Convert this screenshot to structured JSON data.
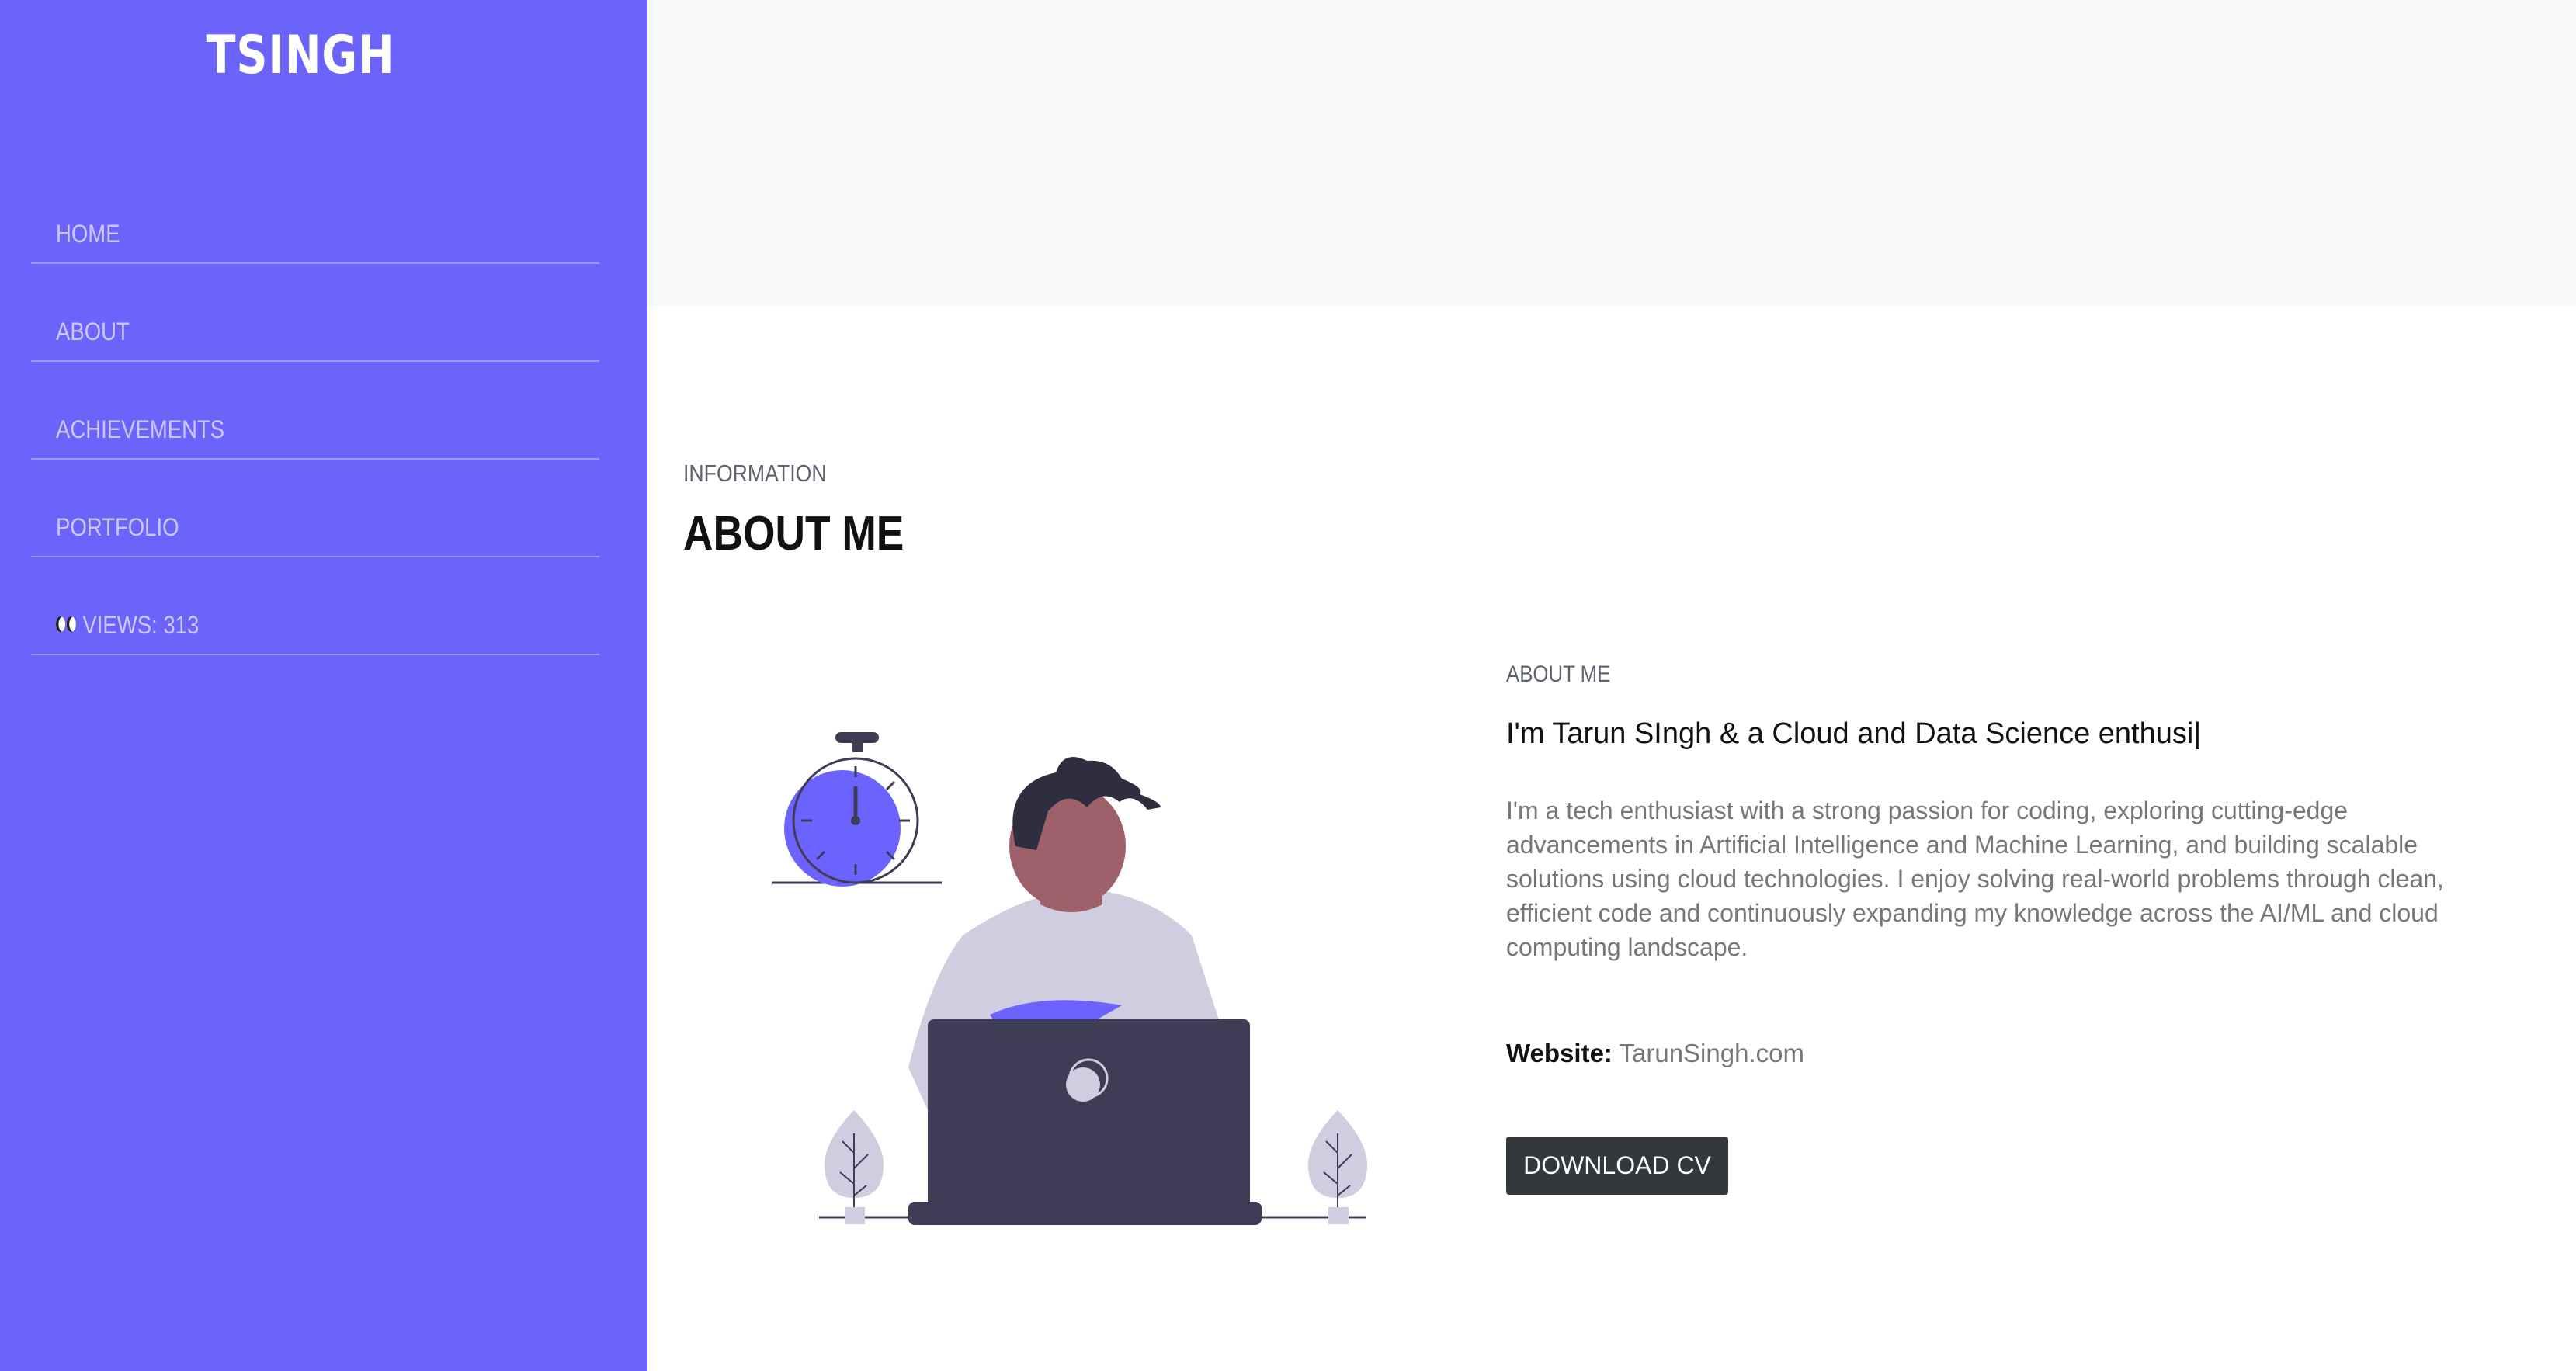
{
  "brand": {
    "logo": "TSINGH"
  },
  "sidebar": {
    "items": [
      {
        "label": "HOME"
      },
      {
        "label": "ABOUT"
      },
      {
        "label": "ACHIEVEMENTS"
      },
      {
        "label": "PORTFOLIO"
      },
      {
        "label": "VIEWS: 313",
        "icon": "eyes-icon"
      }
    ]
  },
  "section": {
    "subtitle": "INFORMATION",
    "title": "ABOUT ME"
  },
  "about": {
    "label": "ABOUT ME",
    "intro": "I'm Tarun SIngh & a Cloud and Data Science enthusi|",
    "bio": "I'm a tech enthusiast with a strong passion for coding, exploring cutting-edge advancements in Artificial Intelligence and Machine Learning, and building scalable solutions using cloud technologies. I enjoy solving real-world problems through clean, efficient code and continuously expanding my knowledge across the AI/ML and cloud computing landscape.",
    "website_key": "Website:",
    "website_value": "TarunSingh.com",
    "cv_button": "DOWNLOAD CV"
  },
  "colors": {
    "sidebar": "#6c63fa",
    "accent": "#6c63ff",
    "button": "#34383d",
    "top_band": "#f7f8fa"
  }
}
